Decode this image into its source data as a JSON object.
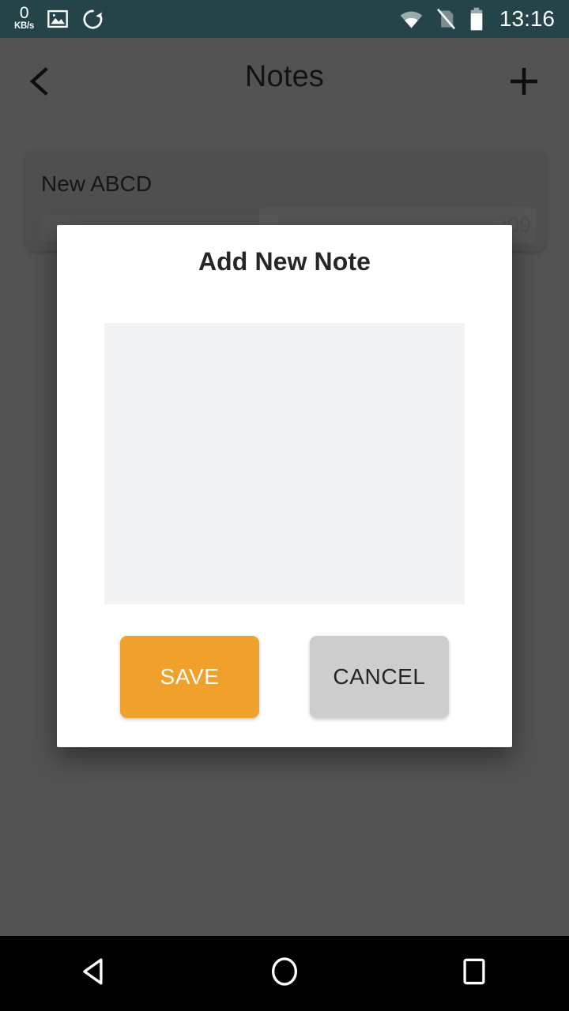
{
  "status_bar": {
    "network_speed_value": "0",
    "network_speed_unit": "KB/s",
    "icons": [
      "image-icon",
      "sync-icon",
      "wifi-icon",
      "sim-off-icon",
      "battery-icon"
    ],
    "time": "13:16",
    "background_color": "#254449"
  },
  "app_bar": {
    "back_icon": "chevron-left-icon",
    "title": "Notes",
    "add_icon": "plus-icon"
  },
  "notes": [
    {
      "title": "New ABCD",
      "timestamp_partial": ":09"
    }
  ],
  "dialog": {
    "title": "Add New Note",
    "input_value": "",
    "input_placeholder": "",
    "save_label": "SAVE",
    "cancel_label": "CANCEL",
    "save_color": "#f0a12c",
    "cancel_color": "#cdcdcd"
  },
  "nav_bar": {
    "back_icon": "nav-back-triangle-icon",
    "home_icon": "nav-home-circle-icon",
    "recents_icon": "nav-recents-square-icon"
  }
}
